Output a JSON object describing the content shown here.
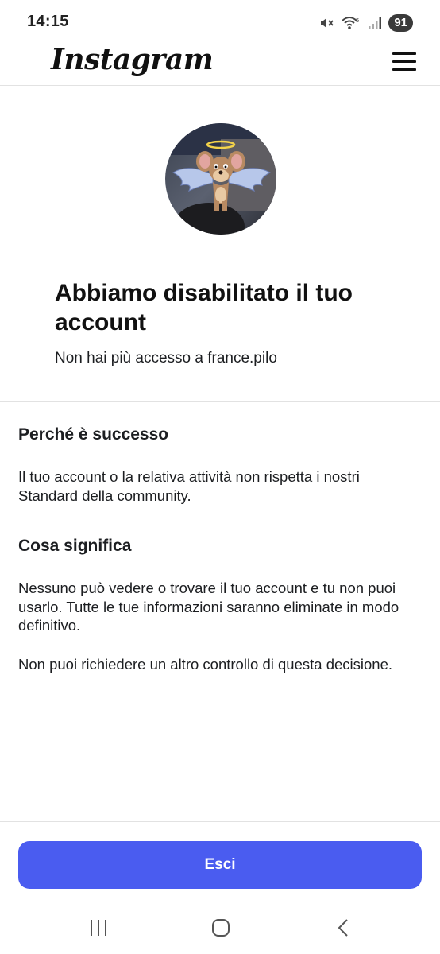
{
  "status_bar": {
    "time": "14:15",
    "battery": "91",
    "icons": [
      "mute-icon",
      "wifi-icon",
      "signal-icon"
    ]
  },
  "header": {
    "logo": "Instagram",
    "menu_icon": "hamburger-menu-icon"
  },
  "hero": {
    "title": "Abbiamo disabilitato il tuo account",
    "subtitle": "Non hai più accesso a france.pilo"
  },
  "why": {
    "heading": "Perché è successo",
    "body": "Il tuo account o la relativa attività non rispetta i nostri Standard della community."
  },
  "meaning": {
    "heading": "Cosa significa",
    "body1": "Nessuno può vedere o trovare il tuo account e tu non puoi usarlo. Tutte le tue informazioni saranno eliminate in modo definitivo.",
    "body2": "Non puoi richiedere un altro controllo di questa decisione."
  },
  "actions": {
    "exit_label": "Esci"
  },
  "colors": {
    "accent": "#4a5cf0"
  },
  "system_nav": [
    "recent-apps-icon",
    "home-icon",
    "back-icon"
  ]
}
